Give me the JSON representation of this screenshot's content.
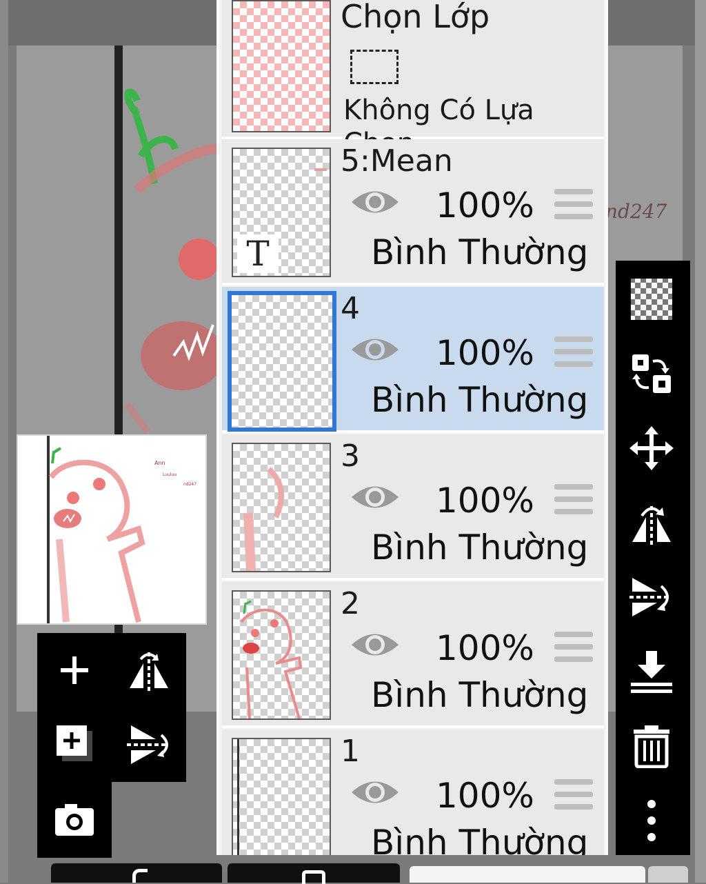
{
  "selection_layer": {
    "title": "Chọn Lớp",
    "status": "Không Có Lựa Chọn"
  },
  "layers": [
    {
      "name": "5:Mean",
      "opacity": "100%",
      "blend": "Bình Thường",
      "visible": true,
      "type": "text"
    },
    {
      "name": "4",
      "opacity": "100%",
      "blend": "Bình Thường",
      "visible": true,
      "selected": true
    },
    {
      "name": "3",
      "opacity": "100%",
      "blend": "Bình Thường",
      "visible": true
    },
    {
      "name": "2",
      "opacity": "100%",
      "blend": "Bình Thường",
      "visible": true
    },
    {
      "name": "1",
      "opacity": "100%",
      "blend": "Bình Thường",
      "visible": true
    }
  ],
  "text_layer_glyph": "T",
  "canvas_side_text": "nd247",
  "right_toolbar": [
    "transparency-icon",
    "swap-layers-icon",
    "move-icon",
    "flip-horizontal-icon",
    "flip-vertical-icon",
    "merge-down-icon",
    "delete-icon",
    "more-icon"
  ],
  "left_toolbar": [
    "add-layer-icon",
    "flip-horizontal-icon",
    "add-layer-copy-icon",
    "flip-vertical-icon",
    "camera-icon"
  ],
  "colors": {
    "selected_row": "#c9daef",
    "selected_border": "#2f78d8",
    "toolbar_bg": "#000000"
  }
}
